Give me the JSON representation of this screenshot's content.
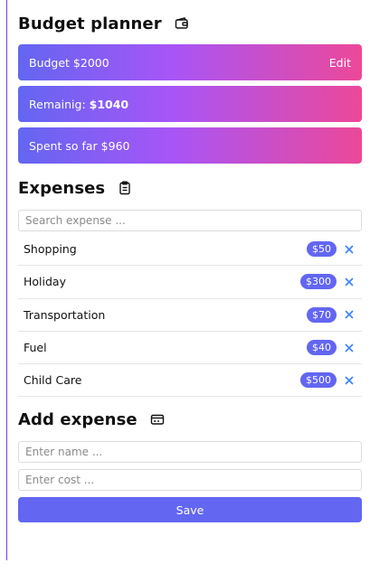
{
  "budget": {
    "title": "Budget planner",
    "title_icon": "wallet-icon",
    "budget_label": "Budget $2000",
    "edit_label": "Edit",
    "remaining_prefix": "Remainig: ",
    "remaining_value": "$1040",
    "spent_label": "Spent so far $960"
  },
  "expenses": {
    "title": "Expenses",
    "title_icon": "clipboard-icon",
    "search_placeholder": "Search expense ...",
    "items": [
      {
        "name": "Shopping",
        "cost": "$50"
      },
      {
        "name": "Holiday",
        "cost": "$300"
      },
      {
        "name": "Transportation",
        "cost": "$70"
      },
      {
        "name": "Fuel",
        "cost": "$40"
      },
      {
        "name": "Child Care",
        "cost": "$500"
      }
    ],
    "remove_icon": "close-icon"
  },
  "add_expense": {
    "title": "Add expense",
    "title_icon": "credit-card-icon",
    "name_placeholder": "Enter name ...",
    "cost_placeholder": "Enter cost ...",
    "save_label": "Save"
  },
  "colors": {
    "accent": "#6366f1",
    "gradient_mid": "#a855f7",
    "gradient_end": "#ec4899",
    "remove": "#3b82f6"
  }
}
